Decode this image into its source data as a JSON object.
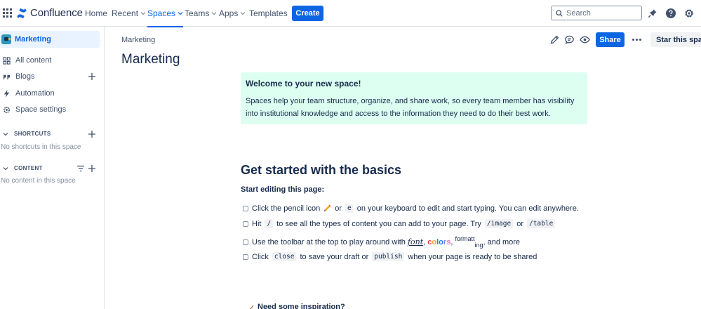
{
  "topnav": {
    "product": "Confluence",
    "items": [
      {
        "label": "Home"
      },
      {
        "label": "Recent"
      },
      {
        "label": "Spaces"
      },
      {
        "label": "Teams"
      },
      {
        "label": "Apps"
      },
      {
        "label": "Templates"
      }
    ],
    "create_label": "Create",
    "search_placeholder": "Search",
    "accent": "#0c66e4"
  },
  "sidebar": {
    "space_name": "Marketing",
    "items": [
      {
        "label": "All content"
      },
      {
        "label": "Blogs"
      },
      {
        "label": "Automation"
      },
      {
        "label": "Space settings"
      }
    ],
    "shortcuts_header": "SHORTCUTS",
    "shortcuts_empty": "No shortcuts in this space",
    "content_header": "CONTENT",
    "content_empty": "No content in this space"
  },
  "page": {
    "breadcrumb": "Marketing",
    "title": "Marketing",
    "share_label": "Share",
    "star_label": "Star this space",
    "panel": {
      "title": "Welcome to your new space!",
      "body": "Spaces help your team structure, organize, and share work, so every team member has visibility into institutional knowledge and access to the information they need to do their best work.",
      "color": "#dcfff1"
    },
    "section_title": "Get started with the basics",
    "subheading": "Start editing this page:",
    "tasks": {
      "t1": {
        "a": "Click the pencil icon",
        "b": "or",
        "code": "e",
        "c": "on your keyboard to edit and start typing. You can edit anywhere."
      },
      "t2": {
        "a": "Hit",
        "code1": "/",
        "b": "to see all the types of content you can add to your page. Try",
        "code2": "/image",
        "c": "or",
        "code3": "/table"
      },
      "t3": {
        "a": "Use the toolbar at the top to play around with",
        "font": "font",
        "comma1": ",",
        "colors": [
          "c",
          "o",
          "l",
          "o",
          "r",
          "s"
        ],
        "comma2": ",",
        "sup": "formatt",
        "sub": "ing",
        "c": ", and more"
      },
      "t4": {
        "a": "Click",
        "code1": "close",
        "b": "to save your draft or",
        "code2": "publish",
        "c": "when your page is ready to be shared"
      }
    },
    "inspiration": "Need some inspiration?"
  }
}
